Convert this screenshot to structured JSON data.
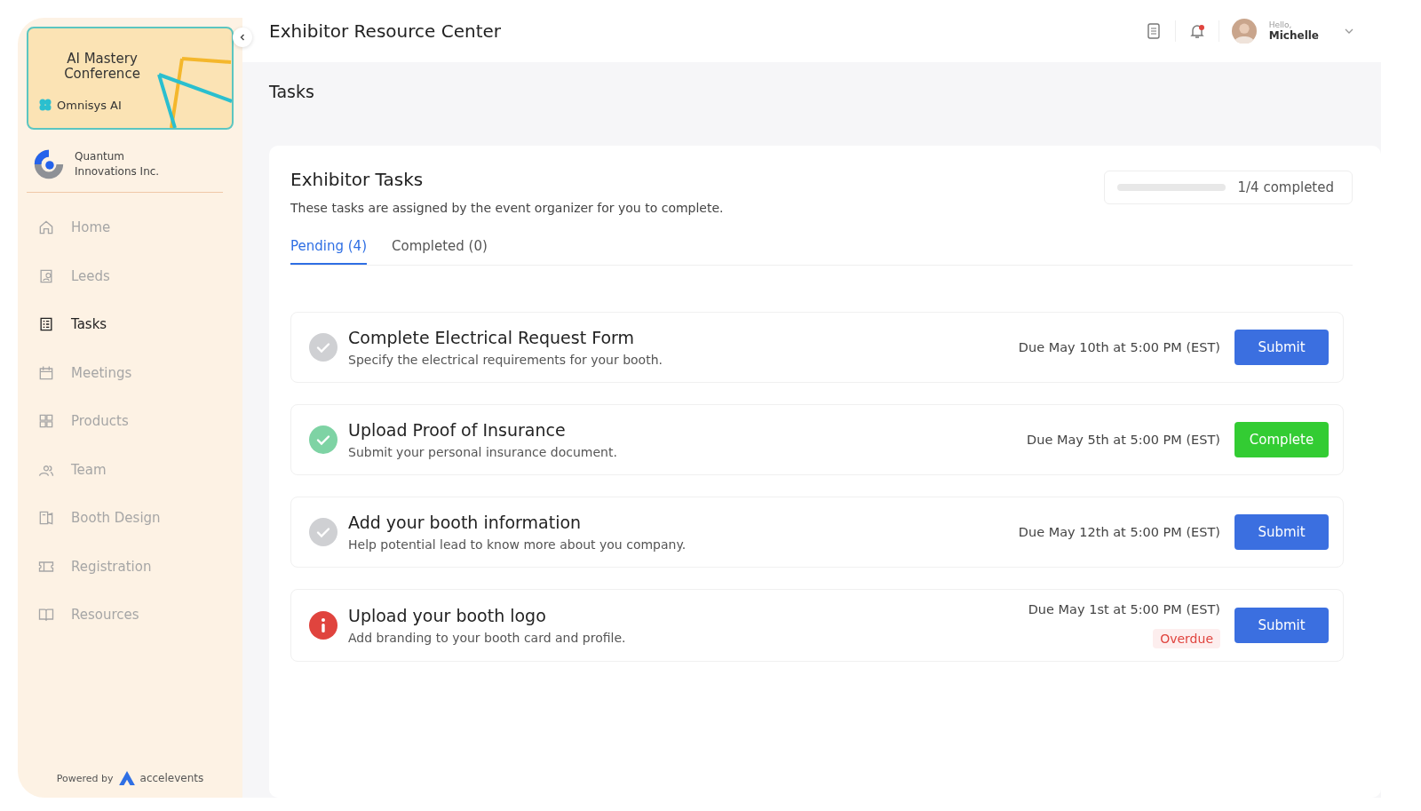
{
  "sidebar": {
    "banner": {
      "title_line_1": "AI Mastery",
      "title_line_2": "Conference",
      "brand": "Omnisys AI"
    },
    "company": {
      "line_1": "Quantum",
      "line_2": "Innovations Inc."
    },
    "items": [
      {
        "label": "Home",
        "selected": false
      },
      {
        "label": "Leeds",
        "selected": false
      },
      {
        "label": "Tasks",
        "selected": true
      },
      {
        "label": "Meetings",
        "selected": false
      },
      {
        "label": "Products",
        "selected": false
      },
      {
        "label": "Team",
        "selected": false
      },
      {
        "label": "Booth Design",
        "selected": false
      },
      {
        "label": "Registration",
        "selected": false
      },
      {
        "label": "Resources",
        "selected": false
      }
    ],
    "footer": {
      "prefix": "Powered by",
      "brand": "accelevents"
    }
  },
  "header": {
    "title": "Exhibitor Resource Center",
    "notification": true,
    "greeting": "Hello,",
    "user": "Michelle"
  },
  "page_title": "Tasks",
  "card": {
    "title": "Exhibitor Tasks",
    "subtitle": "These tasks are assigned by the event organizer for you to complete.",
    "progress": {
      "reading": "1/4 completed"
    },
    "tabs": [
      {
        "label": "Pending (4)",
        "selected": true
      },
      {
        "label": "Completed (0)",
        "selected": false
      }
    ],
    "tasks": [
      {
        "kind": "pending",
        "title": "Complete Electrical Request Form",
        "description": "Specify the electrical requirements for your booth.",
        "due": "Due May 10th at 5:00 PM (EST)",
        "action": {
          "kind": "submit",
          "label": "Submit"
        }
      },
      {
        "kind": "done",
        "title": "Upload Proof of Insurance",
        "description": "Submit your personal insurance document.",
        "due": "Due May 5th at 5:00 PM (EST)",
        "action": {
          "kind": "complete",
          "label": "Complete"
        }
      },
      {
        "kind": "pending",
        "title": "Add your booth information",
        "description": "Help potential lead to know more about you company.",
        "due": "Due May 12th at 5:00 PM (EST)",
        "action": {
          "kind": "submit",
          "label": "Submit"
        }
      },
      {
        "kind": "overdue",
        "title": "Upload your booth logo",
        "description": "Add branding to your booth card and profile.",
        "due": "Due May 1st at 5:00 PM (EST)",
        "badge": "Overdue",
        "action": {
          "kind": "submit",
          "label": "Submit"
        }
      }
    ]
  }
}
